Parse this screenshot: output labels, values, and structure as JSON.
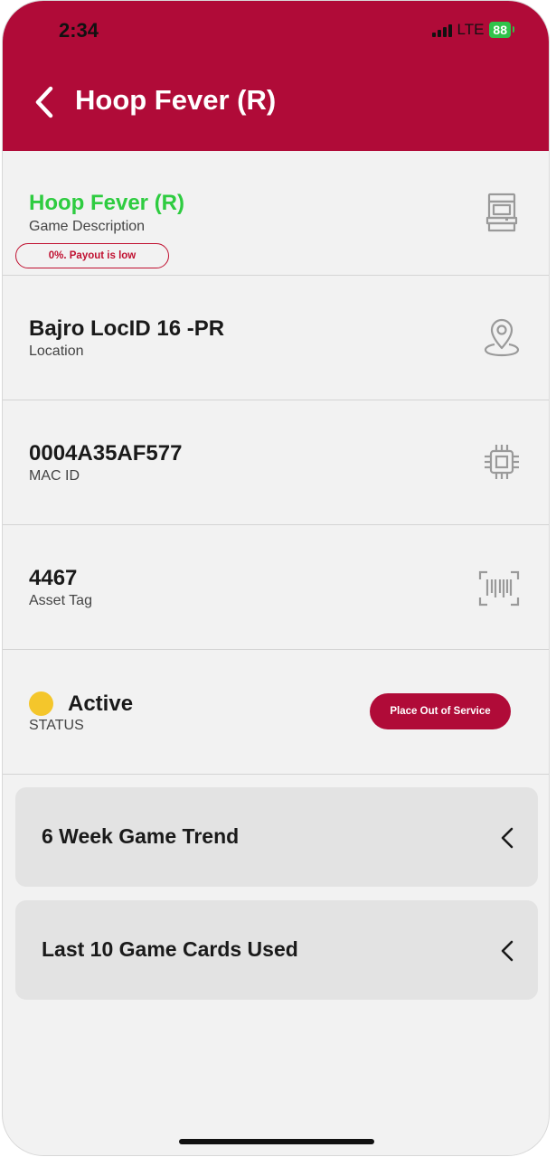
{
  "status_bar": {
    "time": "2:34",
    "network": "LTE",
    "battery": "88"
  },
  "header": {
    "title": "Hoop Fever (R)"
  },
  "game": {
    "value": "Hoop Fever (R)",
    "label": "Game Description",
    "badge": "0%. Payout is low",
    "icon": "arcade-machine-icon"
  },
  "location": {
    "value": "Bajro LocID 16 -PR",
    "label": "Location",
    "icon": "map-pin-icon"
  },
  "mac": {
    "value": "0004A35AF577",
    "label": "MAC ID",
    "icon": "chip-icon"
  },
  "asset": {
    "value": "4467",
    "label": "Asset Tag",
    "icon": "barcode-icon"
  },
  "status": {
    "value": "Active",
    "label": "STATUS",
    "dot_color": "#f4c62b",
    "button": "Place Out of Service"
  },
  "sections": [
    {
      "label": "6 Week Game Trend"
    },
    {
      "label": "Last 10 Game Cards Used"
    }
  ],
  "colors": {
    "brand": "#b00b38",
    "game_title": "#2ecc40",
    "background": "#f2f2f2"
  }
}
